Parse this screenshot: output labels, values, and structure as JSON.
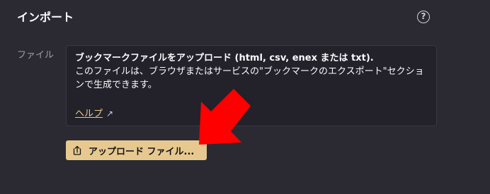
{
  "header": {
    "title": "インポート",
    "help_icon": "help-icon"
  },
  "file_field": {
    "label": "ファイル"
  },
  "info_box": {
    "heading": "ブックマークファイルをアップロード (html, csv, enex または txt).",
    "description": "このファイルは、ブラウザまたはサービスの\"ブックマークのエクスポート\"セクションで生成できます。",
    "help_link": "ヘルプ",
    "external_icon": "external-link-icon"
  },
  "upload": {
    "label": "アップロード ファイル...",
    "icon": "upload-icon"
  },
  "annotation": {
    "icon": "red-arrow-icon",
    "color": "#ff0000"
  },
  "colors": {
    "background": "#2b2a33",
    "accent": "#e7c98f",
    "link": "#e9c98a"
  }
}
